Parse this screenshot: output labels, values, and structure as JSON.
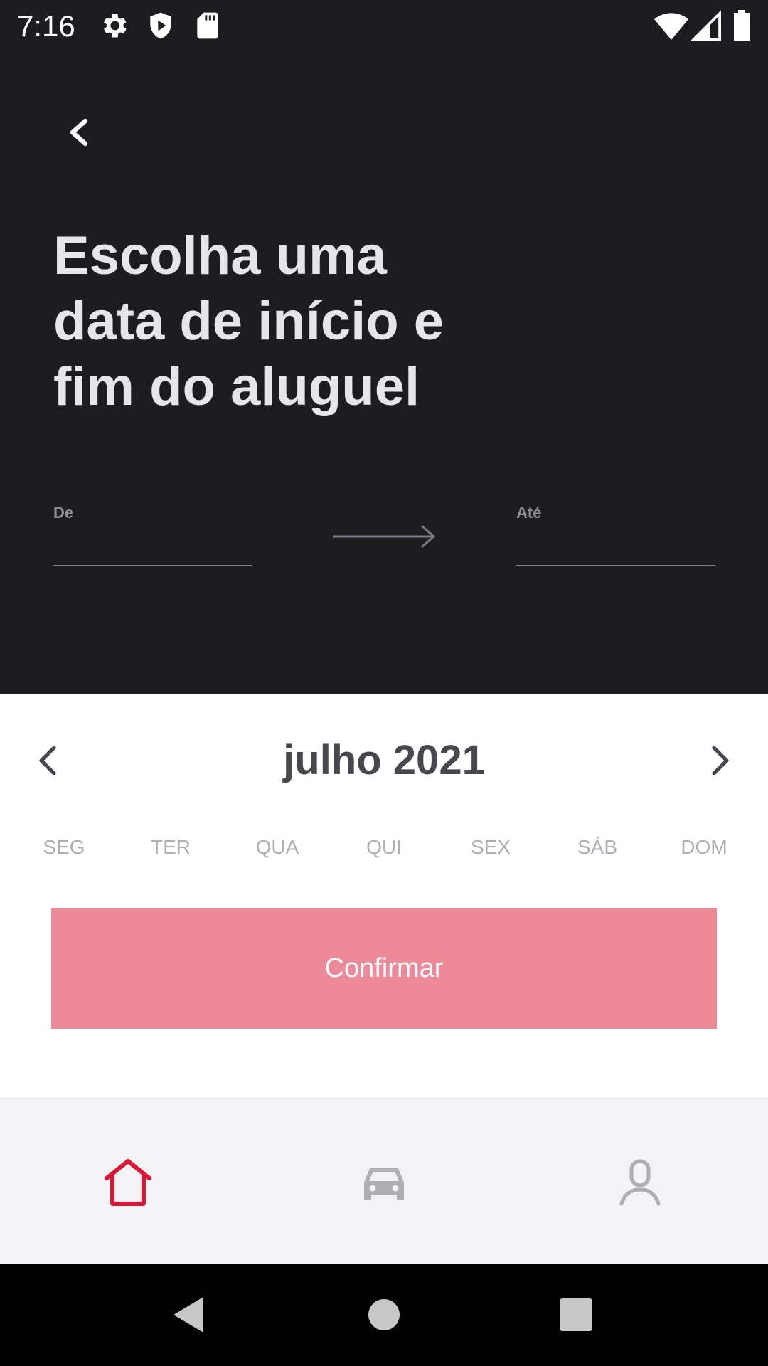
{
  "status_bar": {
    "time": "7:16",
    "icons": [
      "settings-icon",
      "shield-play-icon",
      "sd-card-icon",
      "wifi-icon",
      "signal-icon",
      "battery-icon"
    ]
  },
  "header": {
    "back_icon": "chevron-left-icon",
    "title": "Escolha uma\ndata de início e\nfim do aluguel",
    "from_label": "De",
    "from_value": "",
    "to_label": "Até",
    "to_value": "",
    "arrow_icon": "arrow-right-icon"
  },
  "calendar": {
    "month": "julho 2021",
    "prev_icon": "chevron-left-icon",
    "next_icon": "chevron-right-icon",
    "weekdays": [
      "SEG",
      "TER",
      "QUA",
      "QUI",
      "SEX",
      "SÁB",
      "DOM"
    ]
  },
  "confirm_button": {
    "label": "Confirmar"
  },
  "tab_bar": {
    "tabs": [
      {
        "icon": "home-icon",
        "active": true
      },
      {
        "icon": "car-icon",
        "active": false
      },
      {
        "icon": "user-icon",
        "active": false
      }
    ],
    "active_color": "#dc1637",
    "inactive_color": "#aeaeb3"
  },
  "colors": {
    "header_bg": "#1c1c21",
    "button_bg": "#ec8a99",
    "month_text": "#47474d"
  }
}
